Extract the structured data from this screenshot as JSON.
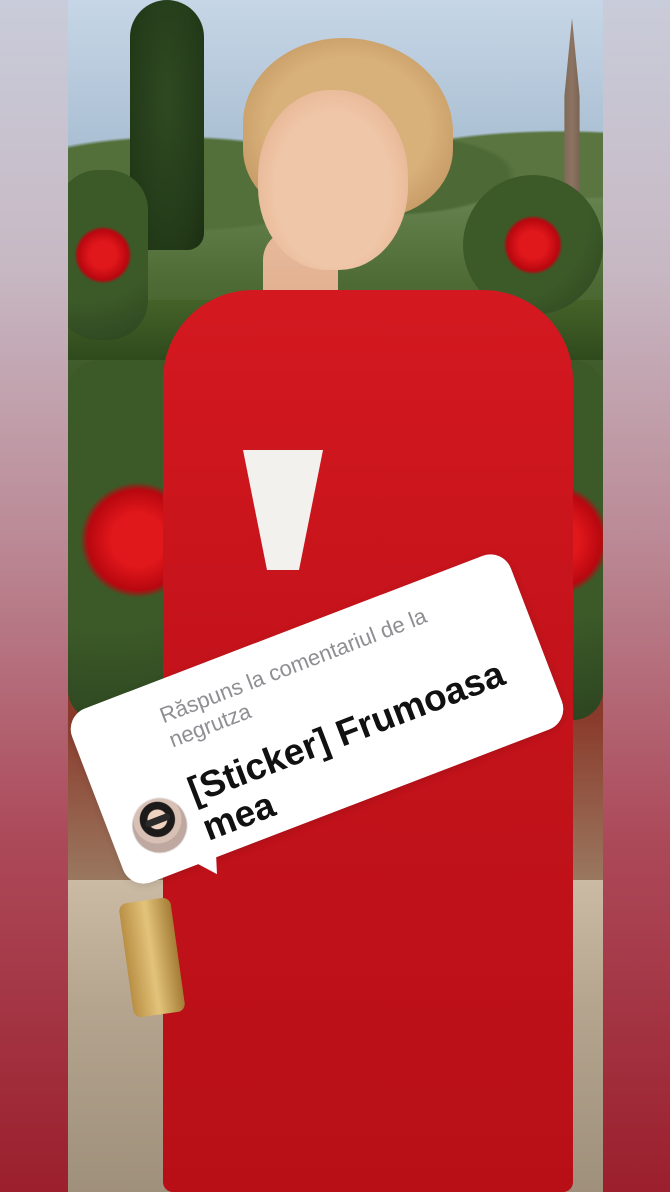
{
  "reply": {
    "header": "Răspuns la comentariul de la negrutza",
    "comment_text": "[Sticker] Frumoasa mea",
    "avatar_icon": "commenter-avatar"
  },
  "colors": {
    "sticker_bg": "#ffffff",
    "reply_header_color": "#8e8e93",
    "comment_text_color": "#111111",
    "suit_red": "#d41820"
  }
}
